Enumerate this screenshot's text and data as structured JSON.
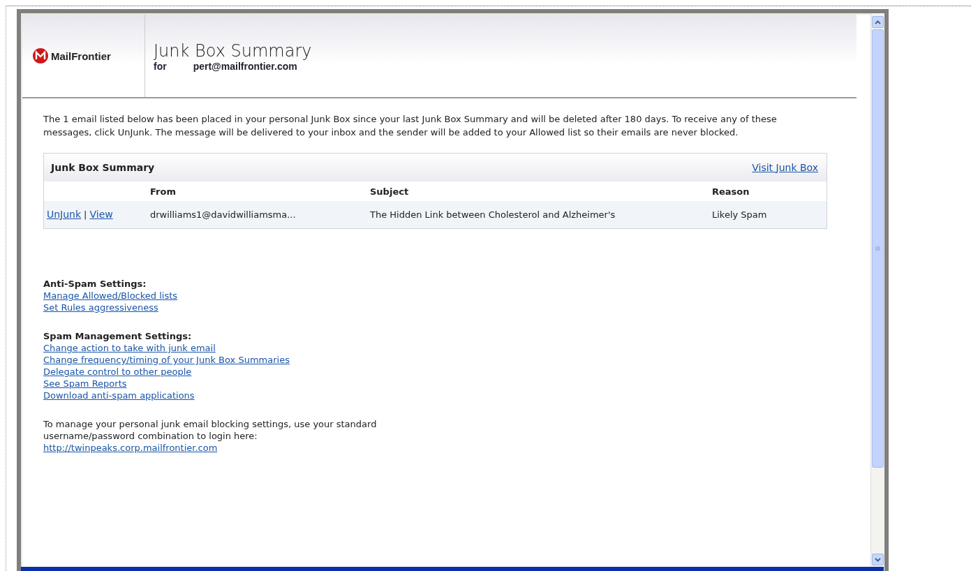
{
  "header": {
    "brand": "MailFrontier",
    "title": "Junk Box Summary",
    "for_label": "for",
    "recipient": "pert@mailfrontier.com"
  },
  "intro": "The 1 email listed below has been placed in your personal Junk Box since your last Junk Box Summary and will be deleted after 180 days. To receive any of these messages, click UnJunk. The message will be delivered to your inbox and the sender will be added to your Allowed list so their emails are never blocked.",
  "summary_table": {
    "title": "Junk Box Summary",
    "visit_link": "Visit Junk Box",
    "columns": [
      "From",
      "Subject",
      "Reason"
    ],
    "rows": [
      {
        "actions": [
          "UnJunk",
          "View"
        ],
        "separator": "|",
        "from": "drwilliams1@davidwilliamsma...",
        "subject": "The Hidden Link between Cholesterol and Alzheimer's",
        "reason": "Likely Spam"
      }
    ]
  },
  "settings": [
    {
      "heading": "Anti-Spam Settings:",
      "links": [
        "Manage Allowed/Blocked lists",
        "Set Rules aggressiveness"
      ]
    },
    {
      "heading": "Spam Management Settings:",
      "links": [
        "Change action to take with junk email",
        "Change frequency/timing of your Junk Box Summaries",
        "Delegate control to other people",
        "See Spam Reports",
        "Download anti-spam applications"
      ]
    }
  ],
  "login_note": "To manage your personal junk email blocking settings, use your standard username/password combination to login here:",
  "login_url": "http://twinpeaks.corp.mailfrontier.com"
}
